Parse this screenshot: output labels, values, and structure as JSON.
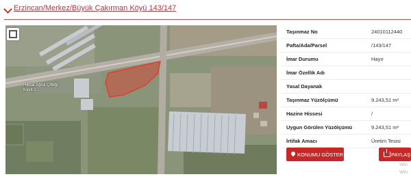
{
  "header": {
    "title": "Erzincan/Merkez/Büyük Çakırman Köyü 143/147"
  },
  "map": {
    "place_label_line1": "Hiksar Ağrol Çiftliği",
    "place_label_line2": "Kayıt 1"
  },
  "info": {
    "rows": [
      {
        "key": "Taşınmaz No",
        "value": "24010112440"
      },
      {
        "key": "Pafta/Ada/Parsel",
        "value": "/143/147"
      },
      {
        "key": "İmar Durumu",
        "value": "Hayır"
      },
      {
        "key": "İmar Özellik Adı",
        "value": ""
      },
      {
        "key": "Yasal Dayanak",
        "value": ""
      },
      {
        "key": "Taşınmaz Yüzölçümü",
        "value": "9.243,51 m²"
      },
      {
        "key": "Hazine Hissesi",
        "value": "/"
      },
      {
        "key": "Uygun Görülen Yüzölçümü",
        "value": "9.243,51 m²"
      },
      {
        "key": "İrtifak Amacı",
        "value": "Üretim Tesisi"
      }
    ]
  },
  "buttons": {
    "show_location": "KONUMU GÖSTER",
    "share": "PAYLAŞ"
  },
  "watermark": {
    "line1": "Win",
    "line2": "Win"
  },
  "colors": {
    "accent": "#c62828",
    "header_text": "#b8333c",
    "parcel_fill": "#d24a3e"
  }
}
